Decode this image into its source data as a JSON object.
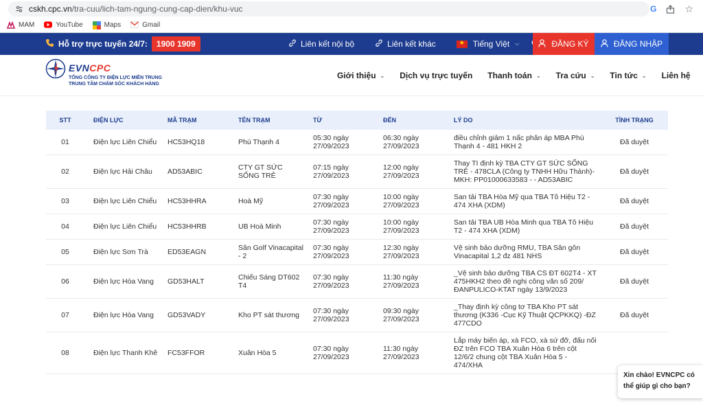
{
  "browser": {
    "url_host": "cskh.cpc.vn",
    "url_path": "/tra-cuu/lich-tam-ngung-cung-cap-dien/khu-vuc",
    "bookmarks": [
      {
        "label": "MAM",
        "icon": "mam-icon"
      },
      {
        "label": "YouTube",
        "icon": "youtube-icon"
      },
      {
        "label": "Maps",
        "icon": "maps-icon"
      },
      {
        "label": "Gmail",
        "icon": "gmail-icon"
      }
    ]
  },
  "topbar": {
    "hotline_label": "Hỗ trợ trực tuyến 24/7:",
    "hotline_number": "1900 1909",
    "internal_link": "Liên kết nội bộ",
    "external_link": "Liên kết khác",
    "language": "Tiếng Việt",
    "register": "ĐĂNG KÝ",
    "login": "ĐĂNG NHẬP"
  },
  "logo": {
    "brand_a": "EVN",
    "brand_b": "CPC",
    "line1": "TỔNG CÔNG TY ĐIỆN LỰC MIỀN TRUNG",
    "line2": "TRUNG TÂM CHĂM SÓC KHÁCH HÀNG"
  },
  "nav": [
    "Giới thiệu",
    "Dịch vụ trực tuyến",
    "Thanh toán",
    "Tra cứu",
    "Tin tức",
    "Liên hệ"
  ],
  "table": {
    "headers": [
      "STT",
      "ĐIỆN LỰC",
      "MÃ TRẠM",
      "TÊN TRẠM",
      "TỪ",
      "ĐẾN",
      "LÝ DO",
      "TÌNH TRẠNG"
    ],
    "rows": [
      [
        "01",
        "Điện lực Liên Chiểu",
        "HC53HQ18",
        "Phú Thạnh 4",
        "05:30 ngày 27/09/2023",
        "06:30 ngày 27/09/2023",
        "điều chỉnh giảm 1 nấc phân áp MBA Phú Thạnh 4 - 481 HKH 2",
        "Đã duyệt"
      ],
      [
        "02",
        "Điện lực Hải Châu",
        "AD53ABIC",
        "CTY GT SỨC SỐNG TRẺ",
        "07:15 ngày 27/09/2023",
        "12:00 ngày 27/09/2023",
        "Thay TI định kỳ TBA CTY GT SỨC SỐNG TRẺ - 478CLA (Công ty TNHH Hữu Thành)-MKH: PP01000633583 - - AD53ABIC",
        "Đã duyệt"
      ],
      [
        "03",
        "Điện lực Liên Chiểu",
        "HC53HHRA",
        "Hoà Mỹ",
        "07:30 ngày 27/09/2023",
        "10:00 ngày 27/09/2023",
        "San tải TBA Hòa Mỹ qua TBA Tô Hiệu T2 - 474 XHA (XDM)",
        "Đã duyệt"
      ],
      [
        "04",
        "Điện lực Liên Chiểu",
        "HC53HHRB",
        "UB Hoà Minh",
        "07:30 ngày 27/09/2023",
        "10:00 ngày 27/09/2023",
        "San tải TBA UB Hòa Minh qua TBA Tô Hiệu T2 - 474 XHA (XDM)",
        "Đã duyệt"
      ],
      [
        "05",
        "Điện lực Sơn Trà",
        "ED53EAGN",
        "Sân Golf Vinacapital - 2",
        "07:30 ngày 27/09/2023",
        "12:30 ngày 27/09/2023",
        "Vệ sinh bảo dưỡng RMU, TBA Sân gôn Vinacapital 1,2 đz 481 NHS",
        "Đã duyệt"
      ],
      [
        "06",
        "Điện lực Hòa Vang",
        "GD53HALT",
        "Chiếu Sáng DT602 T4",
        "07:30 ngày 27/09/2023",
        "11:30 ngày 27/09/2023",
        "_Vệ sinh bảo dưỡng TBA CS ĐT 602T4 - XT 475HKH2 theo đề nghị công văn số 209/ĐANPULICO-KTAT ngày 13/9/2023",
        "Đã duyệt"
      ],
      [
        "07",
        "Điện lực Hòa Vang",
        "GD53VADY",
        "Kho PT sát thương",
        "07:30 ngày 27/09/2023",
        "09:30 ngày 27/09/2023",
        "_Thay định kỳ công tơ TBA Kho PT sát thương (K336 -Cục Kỹ Thuật QCPKKQ) -ĐZ 477CDO",
        "Đã duyệt"
      ],
      [
        "08",
        "Điện lực Thanh Khê",
        "FC53FFOR",
        "Xuân Hòa 5",
        "07:30 ngày 27/09/2023",
        "11:30 ngày 27/09/2023",
        "Lắp máy biến áp, xà FCO, xà sứ đỡ, đấu nối ĐZ trên FCO TBA Xuân Hòa 6 trên cột 12/6/2 chung cột TBA Xuân Hòa 5 - 474/XHA",
        ""
      ]
    ]
  },
  "chat": {
    "line1": "Xin chào! EVNCPC có",
    "line2": "thể giúp gì cho bạn?"
  },
  "colors": {
    "brand_blue": "#1d3c8f",
    "accent_red": "#e8352c",
    "login_blue": "#2e60d2",
    "header_row": "#e9f0fb"
  }
}
